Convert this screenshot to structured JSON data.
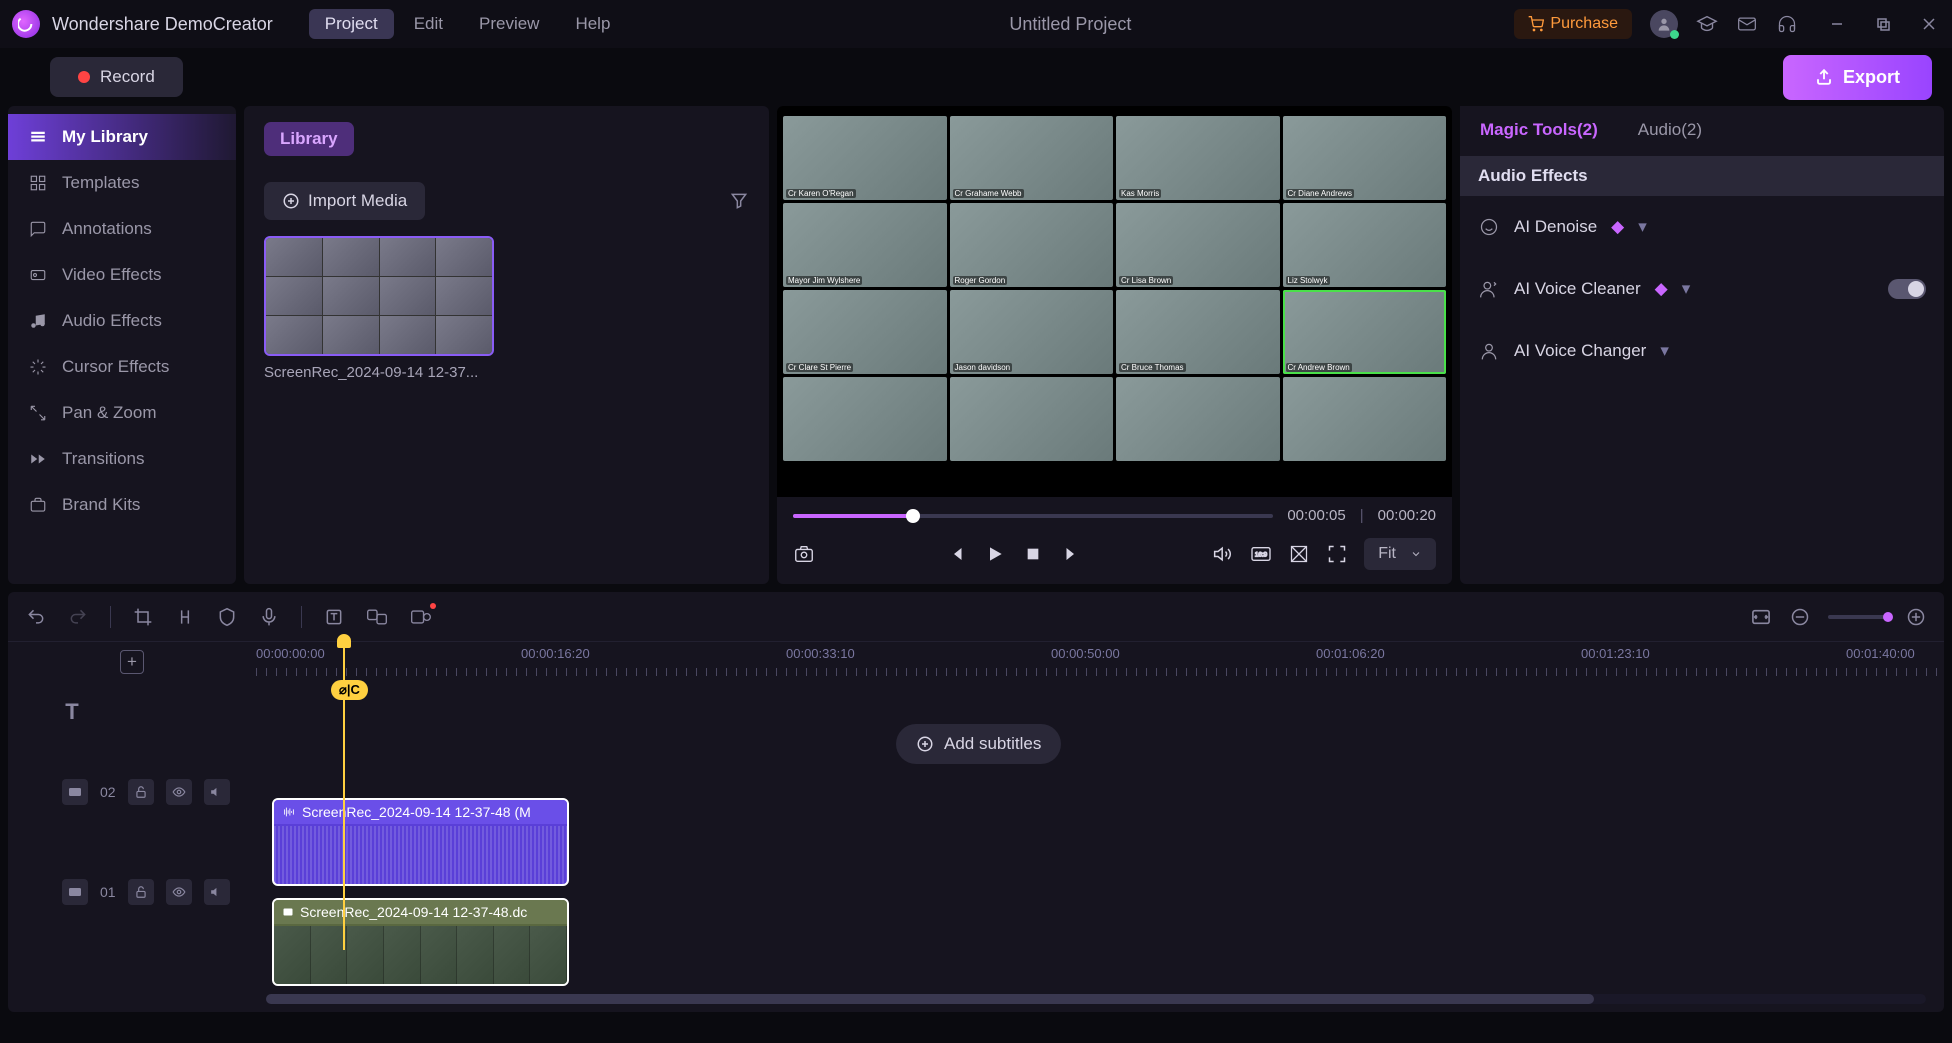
{
  "app": {
    "name": "Wondershare DemoCreator",
    "project_title": "Untitled Project"
  },
  "menu": {
    "items": [
      "Project",
      "Edit",
      "Preview",
      "Help"
    ],
    "active": 0
  },
  "titlebar": {
    "purchase": "Purchase"
  },
  "toolbar": {
    "record": "Record",
    "export": "Export"
  },
  "sidebar": {
    "items": [
      "My Library",
      "Templates",
      "Annotations",
      "Video Effects",
      "Audio Effects",
      "Cursor Effects",
      "Pan & Zoom",
      "Transitions",
      "Brand Kits"
    ],
    "active": 0
  },
  "library": {
    "chip": "Library",
    "import": "Import Media",
    "media_name": "ScreenRec_2024-09-14 12-37..."
  },
  "preview": {
    "time_current": "00:00:05",
    "time_total": "00:00:20",
    "fit_label": "Fit",
    "participants": [
      "Cr Karen O'Regan",
      "Cr Grahame Webb",
      "Kas Morris",
      "Cr Diane Andrews",
      "Mayor Jim Wylshere",
      "Roger Gordon",
      "Cr Lisa Brown",
      "Liz Stolwyk",
      "Cr Clare St Pierre",
      "Jason davidson",
      "Cr Bruce Thomas",
      "Cr Andrew Brown"
    ]
  },
  "props": {
    "tab1": "Magic Tools(2)",
    "tab2": "Audio(2)",
    "header": "Audio Effects",
    "ai_denoise": "AI Denoise",
    "ai_voice_cleaner": "AI Voice Cleaner",
    "ai_voice_changer": "AI Voice Changer"
  },
  "timeline": {
    "ruler": [
      "00:00:00:00",
      "00:00:16:20",
      "00:00:33:10",
      "00:00:50:00",
      "00:01:06:20",
      "00:01:23:10",
      "00:01:40:00"
    ],
    "subtitle_btn": "Add subtitles",
    "track2_label": "02",
    "track1_label": "01",
    "clip_audio": "ScreenRec_2024-09-14 12-37-48 (M",
    "clip_video": "ScreenRec_2024-09-14 12-37-48.dc",
    "playhead_badge": "⌀|C"
  }
}
